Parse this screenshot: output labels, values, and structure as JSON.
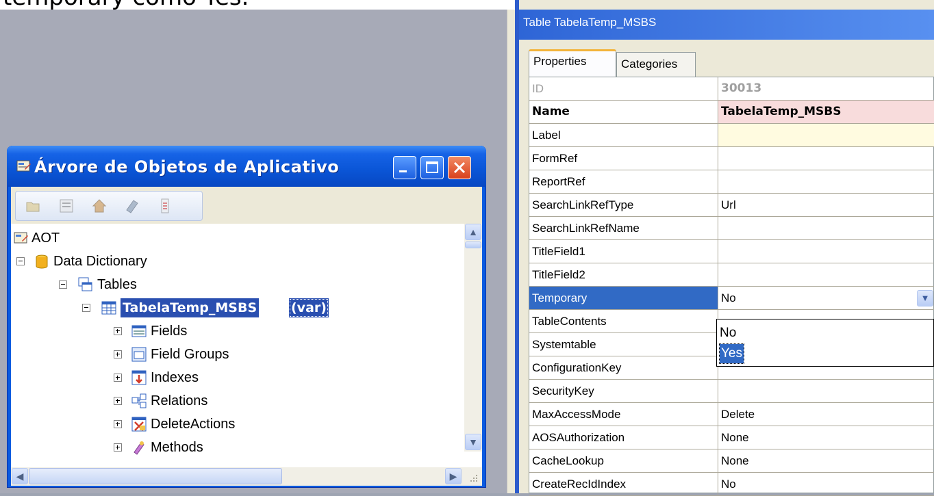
{
  "caption": {
    "text": "temporary como Yes."
  },
  "aot": {
    "title": "Árvore de Objetos de Aplicativo",
    "tree": [
      {
        "label": "AOT"
      },
      {
        "label": "Data Dictionary"
      },
      {
        "label": "Tables"
      },
      {
        "label": "TabelaTemp_MSBS",
        "suffix": "(var)"
      },
      {
        "label": "Fields"
      },
      {
        "label": "Field Groups"
      },
      {
        "label": "Indexes"
      },
      {
        "label": "Relations"
      },
      {
        "label": "DeleteActions"
      },
      {
        "label": "Methods"
      }
    ]
  },
  "props": {
    "title": "Table TabelaTemp_MSBS",
    "tabs": [
      "Properties",
      "Categories"
    ],
    "rows": [
      {
        "name": "ID",
        "value": "30013"
      },
      {
        "name": "Name",
        "value": "TabelaTemp_MSBS"
      },
      {
        "name": "Label",
        "value": ""
      },
      {
        "name": "FormRef",
        "value": ""
      },
      {
        "name": "ReportRef",
        "value": ""
      },
      {
        "name": "SearchLinkRefType",
        "value": "Url"
      },
      {
        "name": "SearchLinkRefName",
        "value": ""
      },
      {
        "name": "TitleField1",
        "value": ""
      },
      {
        "name": "TitleField2",
        "value": ""
      },
      {
        "name": "Temporary",
        "value": "No"
      },
      {
        "name": "TableContents",
        "value": ""
      },
      {
        "name": "Systemtable",
        "value": ""
      },
      {
        "name": "ConfigurationKey",
        "value": ""
      },
      {
        "name": "SecurityKey",
        "value": ""
      },
      {
        "name": "MaxAccessMode",
        "value": "Delete"
      },
      {
        "name": "AOSAuthorization",
        "value": "None"
      },
      {
        "name": "CacheLookup",
        "value": "None"
      },
      {
        "name": "CreateRecIdIndex",
        "value": "No"
      }
    ],
    "dropdown_options": [
      "No",
      "Yes"
    ],
    "selected_option": "Yes"
  },
  "colors": {
    "xp_blue": "#0a5be0",
    "selection": "#2a4fb0",
    "name_highlight": "#f8dcdc",
    "label_highlight": "#fffbe0"
  }
}
